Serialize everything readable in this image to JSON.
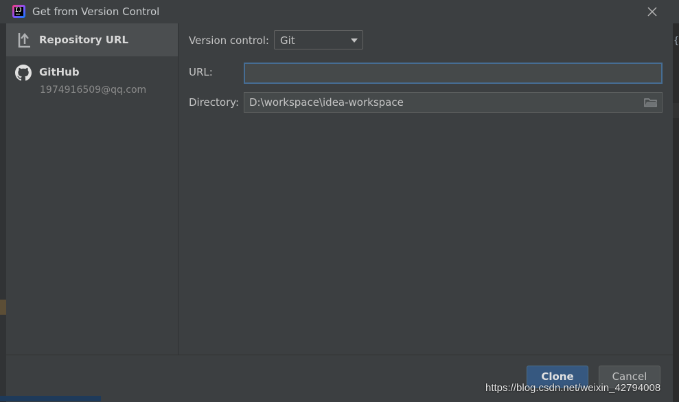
{
  "window": {
    "title": "Get from Version Control",
    "app_icon": "intellij-idea-icon",
    "app_icon_text": "IJ",
    "close_icon": "close-icon"
  },
  "sidebar": {
    "items": [
      {
        "label": "Repository URL",
        "icon": "repository-url-icon",
        "selected": true
      },
      {
        "label": "GitHub",
        "sublabel": "1974916509@qq.com",
        "icon": "github-icon",
        "selected": false
      }
    ]
  },
  "form": {
    "version_control_label": "Version control:",
    "version_control_value": "Git",
    "url_label": "URL:",
    "url_value": "",
    "directory_label": "Directory:",
    "directory_value": "D:\\workspace\\idea-workspace",
    "browse_icon": "folder-icon"
  },
  "buttons": {
    "clone": "Clone",
    "cancel": "Cancel"
  },
  "background_editor": {
    "brace": "{"
  },
  "watermark": "https://blog.csdn.net/weixin_42794008",
  "colors": {
    "dialog_bg": "#3c3f41",
    "selection_bg": "#4b4e50",
    "focus_border": "#466d94",
    "primary_button": "#365880"
  }
}
